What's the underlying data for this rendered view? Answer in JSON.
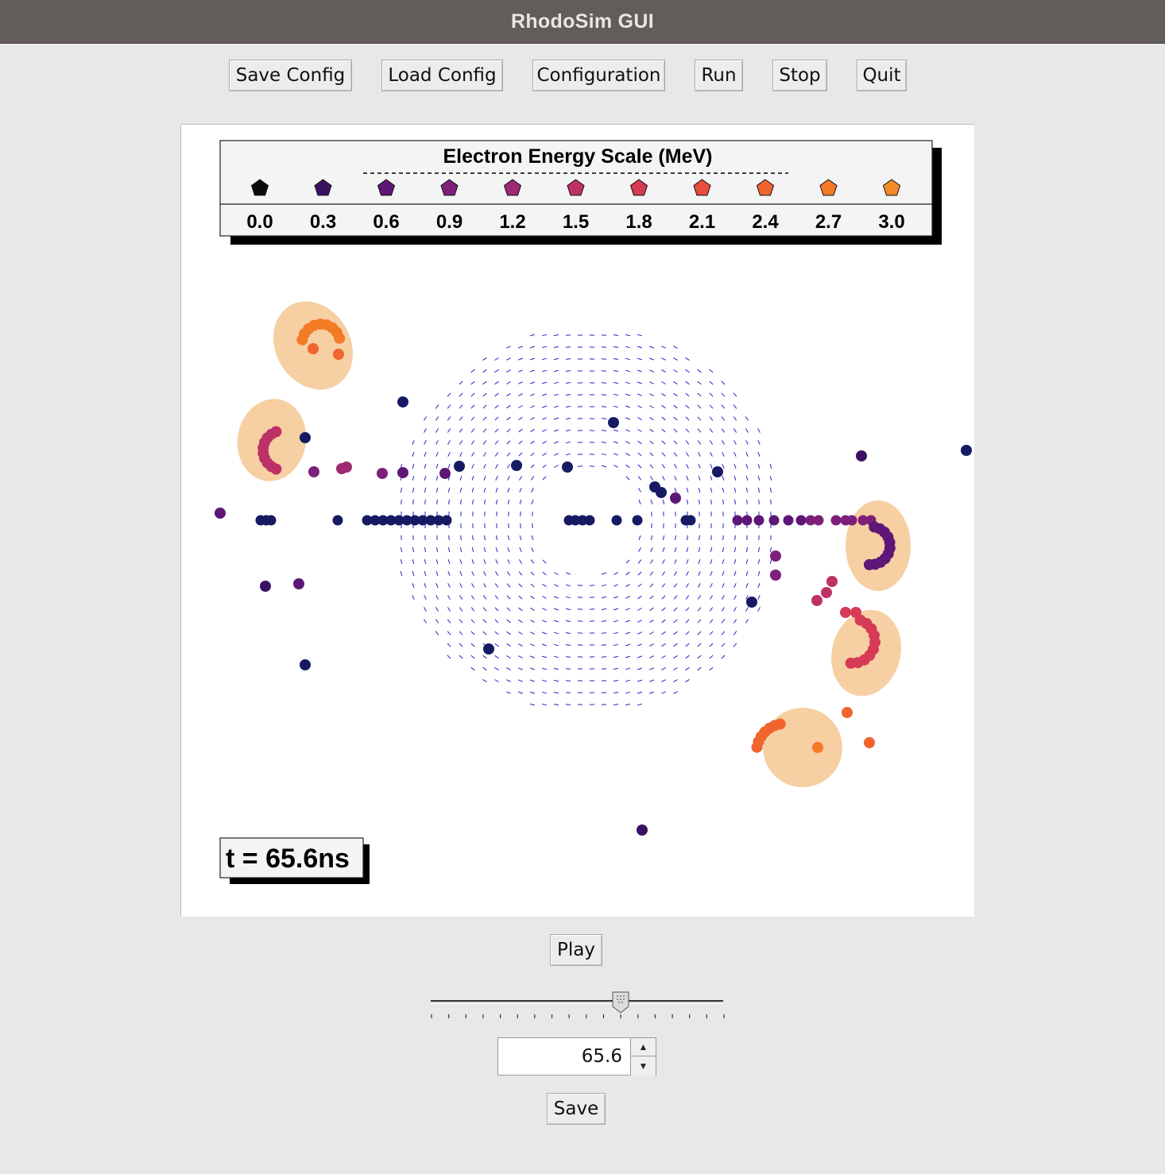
{
  "window": {
    "title": "RhodoSim GUI"
  },
  "toolbar": {
    "save_config": "Save Config",
    "load_config": "Load Config",
    "configuration": "Configuration",
    "run": "Run",
    "stop": "Stop",
    "quit": "Quit"
  },
  "legend": {
    "title": "Electron Energy Scale (MeV)",
    "items": [
      {
        "label": "0.0",
        "color": "#0a0a0a"
      },
      {
        "label": "0.3",
        "color": "#3b1263"
      },
      {
        "label": "0.6",
        "color": "#5e1776"
      },
      {
        "label": "0.9",
        "color": "#7e1f7a"
      },
      {
        "label": "1.2",
        "color": "#9e2a73"
      },
      {
        "label": "1.5",
        "color": "#bd3266"
      },
      {
        "label": "1.8",
        "color": "#d63b56"
      },
      {
        "label": "2.1",
        "color": "#e84c3e"
      },
      {
        "label": "2.4",
        "color": "#f0642d"
      },
      {
        "label": "2.7",
        "color": "#f47a26"
      },
      {
        "label": "3.0",
        "color": "#f58a2a"
      }
    ]
  },
  "time_label": "t = 65.6ns",
  "colors": {
    "field_arrow": "#2a1fc9",
    "bunch_halo": "#f6cfa2",
    "low_energy": "#161a63"
  },
  "playback": {
    "play_label": "Play",
    "slider_fraction": 0.65,
    "time_value": "65.6",
    "save_label": "Save"
  }
}
